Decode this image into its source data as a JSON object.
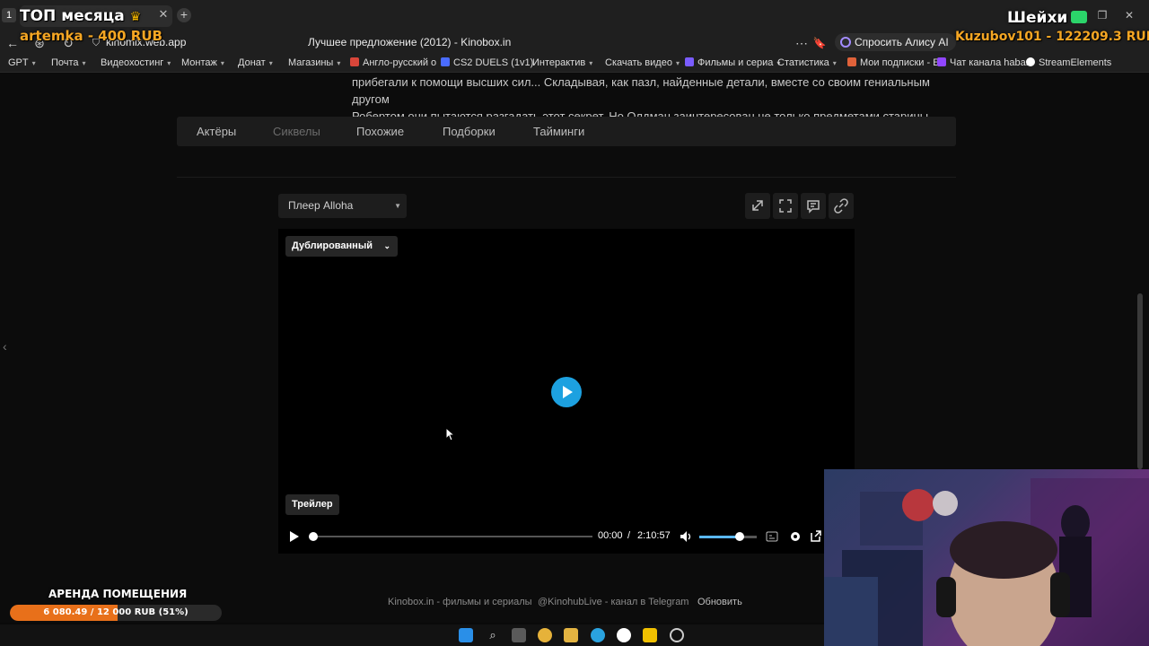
{
  "browser": {
    "tab_number": "1",
    "url": "kinomix.web.app",
    "page_title": "Лучшее предложение (2012) - Kinobox.in",
    "alice_label": "Спросить Алису AI",
    "bookmarks": [
      {
        "label": "GPT",
        "has_menu": true
      },
      {
        "label": "Почта",
        "has_menu": true
      },
      {
        "label": "Видеохостинг",
        "has_menu": true
      },
      {
        "label": "Монтаж",
        "has_menu": true
      },
      {
        "label": "Донат",
        "has_menu": true
      },
      {
        "label": "Магазины",
        "has_menu": true
      },
      {
        "label": "Англо-русский о",
        "has_menu": false,
        "icon_color": "#d9463a"
      },
      {
        "label": "CS2 DUELS (1v1)",
        "has_menu": false,
        "icon_color": "#4a6cff"
      },
      {
        "label": "Интерактив",
        "has_menu": true
      },
      {
        "label": "Скачать видео",
        "has_menu": true
      },
      {
        "label": "Фильмы и сериа",
        "has_menu": true,
        "icon_color": "#7a5cff"
      },
      {
        "label": "Статистика",
        "has_menu": true
      },
      {
        "label": "Мои подписки - E",
        "has_menu": false,
        "icon_color": "#e0623a"
      },
      {
        "label": "Чат канала haban",
        "has_menu": false,
        "icon_color": "#9146ff"
      },
      {
        "label": "StreamElements",
        "has_menu": false,
        "icon_color": "#ffffff"
      }
    ]
  },
  "overlays": {
    "top_month": "ТОП месяца",
    "top_donor": "artemka - 400 RUB",
    "right_title": "Шейхи",
    "right_donor": "Kuzubov101 - 122209.3 RUB",
    "goal_title": "АРЕНДА ПОМЕЩЕНИЯ",
    "goal_text": "6 080.49 / 12 000 RUB (51%)",
    "goal_fraction": 0.51,
    "goal_color": "#e8701a"
  },
  "page": {
    "description_lines": [
      "прибегали к помощи высших сил... Складывая, как пазл, найденные детали, вместе со своим гениальным другом",
      "Робертом они пытаются разгадать этот секрет. Но Олдман заинтересован не только предметами старины..."
    ],
    "tabs": [
      {
        "label": "Актёры",
        "active": true
      },
      {
        "label": "Сиквелы",
        "active": false
      },
      {
        "label": "Похожие",
        "active": true
      },
      {
        "label": "Подборки",
        "active": true
      },
      {
        "label": "Тайминги",
        "active": true
      }
    ],
    "player_select": "Плеер Alloha",
    "player_tools": [
      "expand-icon",
      "fullscreen-icon",
      "comment-icon",
      "link-icon"
    ],
    "video": {
      "dub_label": "Дублированный",
      "trailer_label": "Трейлер",
      "current_time": "00:00",
      "separator": "/",
      "duration": "2:10:57",
      "progress": 0.0,
      "volume": 0.7,
      "accent": "#1da1e0"
    },
    "footer": {
      "site": "Kinobox.in - фильмы и сериалы",
      "telegram": "@KinohubLive - канал в Telegram",
      "refresh": "Обновить"
    }
  }
}
